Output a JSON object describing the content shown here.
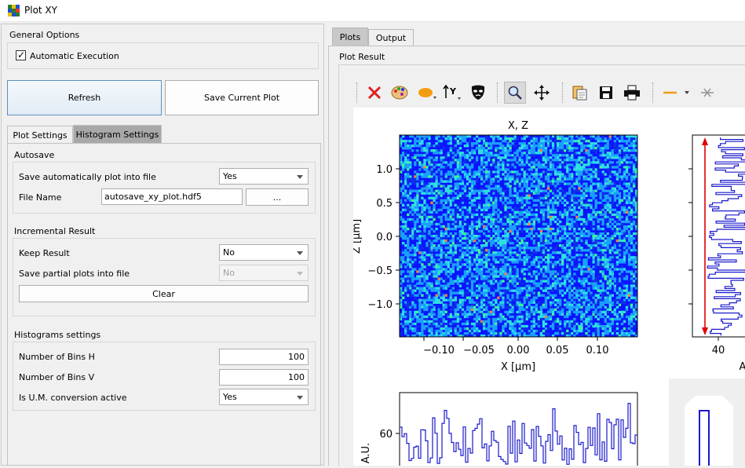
{
  "window": {
    "title": "Plot XY"
  },
  "left": {
    "general_options": {
      "title": "General Options",
      "automatic_execution": {
        "label": "Automatic Execution",
        "checked": true
      }
    },
    "buttons": {
      "refresh": "Refresh",
      "save_current_plot": "Save Current Plot"
    },
    "tabs": [
      "Plot Settings",
      "Histogram Settings"
    ],
    "autosave": {
      "title": "Autosave",
      "save_auto_label": "Save automatically plot into file",
      "save_auto_value": "Yes",
      "file_name_label": "File Name",
      "file_name_value": "autosave_xy_plot.hdf5",
      "browse_label": "..."
    },
    "incremental": {
      "title": "Incremental Result",
      "keep_result_label": "Keep Result",
      "keep_result_value": "No",
      "save_partial_label": "Save partial plots into file",
      "save_partial_value": "No",
      "clear_label": "Clear"
    },
    "histograms": {
      "title": "Histograms settings",
      "bins_h_label": "Number of Bins H",
      "bins_h_value": "100",
      "bins_v_label": "Number of Bins V",
      "bins_v_value": "100",
      "um_label": "Is U.M. conversion active",
      "um_value": "Yes"
    }
  },
  "right": {
    "tabs": [
      "Plots",
      "Output"
    ],
    "plot_result_label": "Plot Result",
    "toolbar_icons": [
      "reset-zoom-icon",
      "colormap-icon",
      "marker-icon",
      "y-axis-icon",
      "mask-icon",
      "zoom-icon",
      "pan-icon",
      "copy-icon",
      "save-icon",
      "print-icon",
      "line-style-icon",
      "crosshair-icon"
    ]
  },
  "plot": {
    "title": "X, Z",
    "xlabel": "X [μm]",
    "ylabel": "Z [μm]",
    "x_ticks": [
      "−0.10",
      "−0.05",
      "0.00",
      "0.05",
      "0.10"
    ],
    "y_ticks": [
      "1.0",
      "0.5",
      "0.0",
      "−0.5",
      "−1.0"
    ],
    "histo_v_xtick": "40",
    "histo_v_xlabel_fragment": "A",
    "histo_h_ylabel": "A.U.",
    "histo_h_ytick": "60"
  },
  "colors": {
    "heatmap": [
      "#0a14ff",
      "#1030e8",
      "#1aa0ff",
      "#2fe0e0",
      "#40ff90",
      "#ff8040"
    ],
    "histogram_line": "#1a1acc",
    "marker_arrow": "#e00000"
  }
}
